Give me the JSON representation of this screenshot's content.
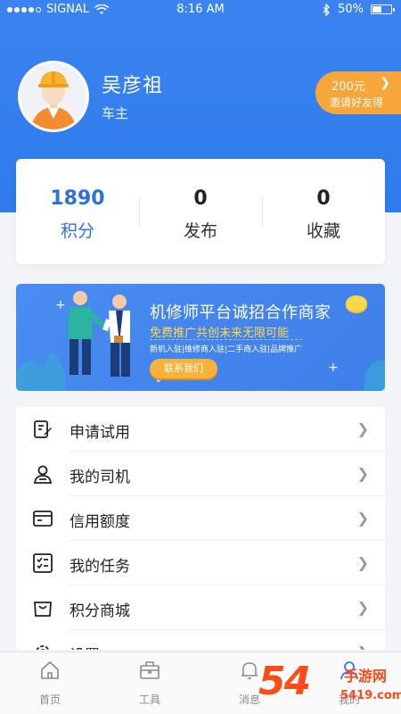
{
  "status_bar": {
    "carrier": "SIGNAL",
    "time": "8:16 AM",
    "battery": "50%",
    "battery_level": 0.5
  },
  "profile": {
    "name": "吴彦祖",
    "role": "车主"
  },
  "invite": {
    "amount": "200元",
    "label": "邀请好友得"
  },
  "stats": [
    {
      "value": "1890",
      "label": "积分"
    },
    {
      "value": "0",
      "label": "发布"
    },
    {
      "value": "0",
      "label": "收藏"
    }
  ],
  "banner": {
    "title": "机修师平台诚招合作商家",
    "subtitle": "免费推广共创未来无限可能",
    "tags": "新机入驻|维修商入驻|二手商入驻|品牌推广",
    "button": "联系我们"
  },
  "menu": [
    {
      "label": "申请试用",
      "icon": "edit-icon"
    },
    {
      "label": "我的司机",
      "icon": "driver-icon"
    },
    {
      "label": "信用额度",
      "icon": "card-icon"
    },
    {
      "label": "我的任务",
      "icon": "checklist-icon"
    },
    {
      "label": "积分商城",
      "icon": "shopping-bag-icon"
    },
    {
      "label": "设置",
      "icon": "gear-icon"
    }
  ],
  "tabbar": [
    {
      "label": "首页",
      "icon": "home-icon"
    },
    {
      "label": "工具",
      "icon": "toolbox-icon"
    },
    {
      "label": "消息",
      "icon": "bell-icon"
    },
    {
      "label": "我的",
      "icon": "user-icon"
    }
  ],
  "watermark": {
    "number": "54",
    "text": "手游网",
    "url": "5419.com"
  },
  "colors": {
    "primary": "#2f7bed",
    "accent": "#f7a63a",
    "watermark": "#ff4a1a"
  }
}
